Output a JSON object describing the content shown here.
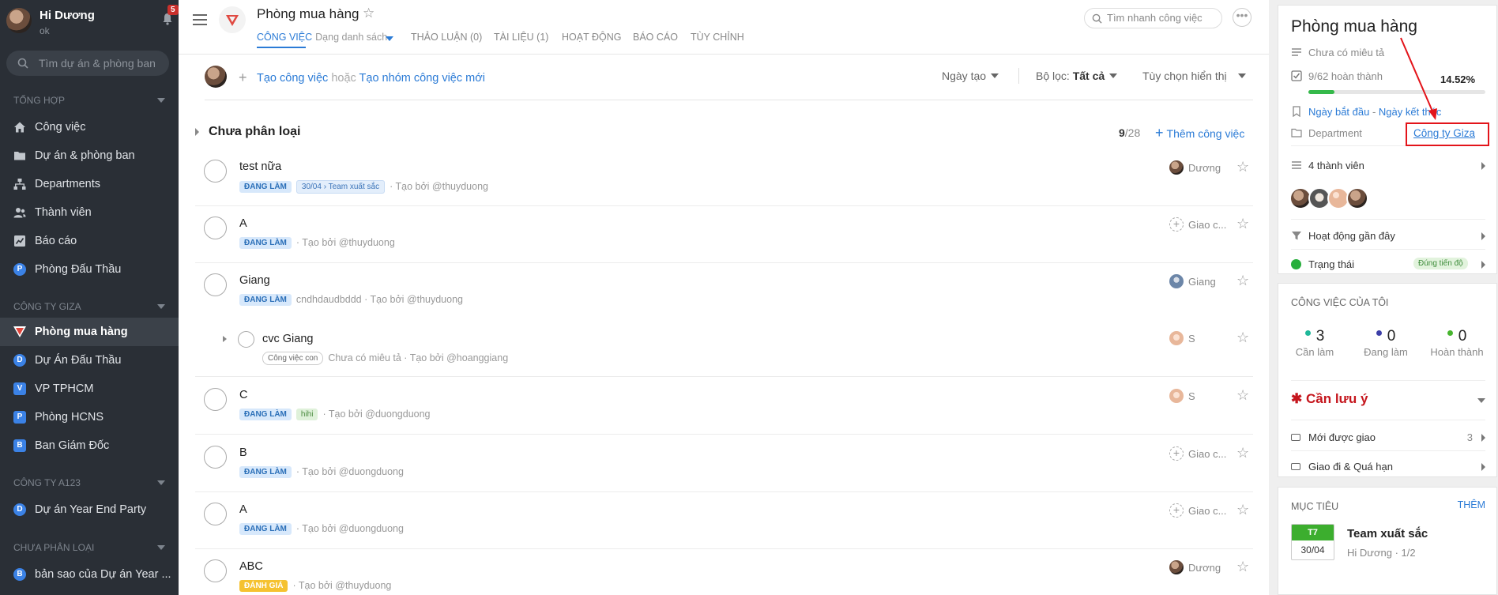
{
  "user": {
    "name": "Hi Dương",
    "status": "ok",
    "notifications": "5"
  },
  "sidebar": {
    "search_placeholder": "Tìm dự án & phòng ban",
    "sections": [
      {
        "title": "TỔNG HỢP"
      },
      {
        "title": "CÔNG TY GIZA"
      },
      {
        "title": "CÔNG TY A123"
      },
      {
        "title": "CHƯA PHÂN LOẠI"
      }
    ],
    "general_items": [
      {
        "label": "Công việc",
        "icon": "home-icon"
      },
      {
        "label": "Dự án & phòng ban",
        "icon": "folder-icon"
      },
      {
        "label": "Departments",
        "icon": "sitemap-icon"
      },
      {
        "label": "Thành viên",
        "icon": "users-icon"
      },
      {
        "label": "Báo cáo",
        "icon": "chart-icon"
      },
      {
        "label": "Phòng Đấu Thầu",
        "badge": "P"
      }
    ],
    "giza_items": [
      {
        "label": "Phòng mua hàng",
        "active": true
      },
      {
        "label": "Dự Án Đấu Thầu",
        "badge": "D"
      },
      {
        "label": "VP TPHCM",
        "badge": "V"
      },
      {
        "label": "Phòng HCNS",
        "badge": "P"
      },
      {
        "label": "Ban Giám Đốc",
        "badge": "B"
      }
    ],
    "a123_items": [
      {
        "label": "Dự án Year End Party",
        "badge": "D"
      }
    ],
    "unsorted_items": [
      {
        "label": "bản sao của Dự án Year ...",
        "badge": "B"
      }
    ]
  },
  "header": {
    "title": "Phòng mua hàng",
    "tabs": [
      {
        "label": "CÔNG VIỆC",
        "view": "Dạng danh sách",
        "active": true
      },
      {
        "label": "THẢO LUẬN (0)"
      },
      {
        "label": "TÀI LIỆU (1)"
      },
      {
        "label": "HOẠT ĐỘNG"
      },
      {
        "label": "BÁO CÁO"
      },
      {
        "label": "TÙY CHỈNH"
      }
    ],
    "search_placeholder": "Tìm nhanh công việc",
    "more": "•••"
  },
  "toolbar": {
    "create_task": "Tạo công việc",
    "or": "hoặc",
    "create_group": "Tạo nhóm công việc mới",
    "sort": "Ngày tạo",
    "filter_label": "Bộ lọc:",
    "filter_value": "Tất cả",
    "display_options": "Tùy chọn hiển thị"
  },
  "group": {
    "title": "Chưa phân loại",
    "done": "9",
    "total": "/28",
    "add_label": "Thêm công việc"
  },
  "tasks": [
    {
      "title": "test nữa",
      "status": "ĐANG LÀM",
      "goal": "30/04 › Team xuất sắc",
      "meta": "· Tạo bởi @thuyduong",
      "assignee": "Dương"
    },
    {
      "title": "A",
      "status": "ĐANG LÀM",
      "meta": "· Tạo bởi @thuyduong",
      "assignee": "Giao c..."
    },
    {
      "title": "Giang",
      "status": "ĐANG LÀM",
      "meta": "cndhdaudbddd · Tạo bởi @thuyduong",
      "assignee": "Giang"
    },
    {
      "title": "cvc Giang",
      "tag": "Công việc con",
      "meta": "Chưa có miêu tả · Tạo bởi @hoanggiang",
      "assignee": "S"
    },
    {
      "title": "C",
      "status": "ĐANG LÀM",
      "label": "hihi",
      "meta": "· Tạo bởi @duongduong",
      "assignee": "S"
    },
    {
      "title": "B",
      "status": "ĐANG LÀM",
      "meta": "· Tạo bởi @duongduong",
      "assignee": "Giao c..."
    },
    {
      "title": "A",
      "status": "ĐANG LÀM",
      "meta": "· Tạo bởi @duongduong",
      "assignee": "Giao c..."
    },
    {
      "title": "ABC",
      "status": "ĐÁNH GIÁ",
      "meta": "· Tạo bởi @thuyduong",
      "assignee": "Dương"
    }
  ],
  "info_panel": {
    "title": "Phòng mua hàng",
    "description": "Chưa có miêu tả",
    "progress_text": "9/62 hoàn thành",
    "progress_pct": "14.52%",
    "progress_fraction": 0.1452,
    "start_date": "Ngày bắt đầu",
    "date_sep": " - ",
    "end_date": "Ngày kết thúc",
    "department_label": "Department",
    "department_value": "Công ty Giza",
    "members": "4 thành viên",
    "recent_activity": "Hoạt động gần đây",
    "status_label": "Trạng thái",
    "status_value": "Đúng tiến độ",
    "highlight_color": "#e3141a"
  },
  "my_tasks": {
    "title": "CÔNG VIỆC CỦA TÔI",
    "stats": [
      {
        "value": "3",
        "label": "Cần làm",
        "color": "#1fb89a"
      },
      {
        "value": "0",
        "label": "Đang làm",
        "color": "#3d3fa8"
      },
      {
        "value": "0",
        "label": "Hoàn thành",
        "color": "#47b52e"
      }
    ],
    "attention": "Cần lưu ý",
    "new_assigned": "Mới được giao",
    "new_assigned_count": "3",
    "overdue": "Giao đi & Quá hạn"
  },
  "goals": {
    "title": "MỤC TIÊU",
    "add": "THÊM",
    "item": {
      "day": "T7",
      "date": "30/04",
      "name": "Team xuất sắc",
      "owner": "Hi Dương",
      "count": "1/2"
    }
  }
}
